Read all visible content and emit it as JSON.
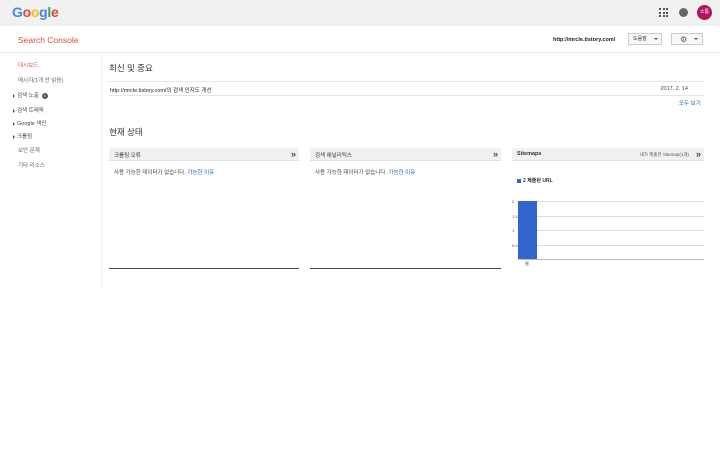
{
  "header": {
    "logo_text": "Google",
    "logo_colors": [
      "#4285f4",
      "#ea4335",
      "#fbbc05",
      "#4285f4",
      "#34a853",
      "#ea4335"
    ],
    "apps_icon": "apps-grid-icon",
    "notifications_icon": "bell-icon",
    "avatar_initials": "소통",
    "avatar_color": "#b0155d"
  },
  "subheader": {
    "product_title": "Search Console",
    "site_url": "http://mrcle.tistory.com/",
    "help_label": "도움말",
    "settings_icon": "gear-icon"
  },
  "sidebar": {
    "items": [
      {
        "label": "대시보드"
      },
      {
        "label": "메시지(1개 안 읽음)"
      },
      {
        "label": "검색 노출"
      },
      {
        "label": "검색 트래픽"
      },
      {
        "label": "Google 색인"
      },
      {
        "label": "크롤링"
      },
      {
        "label": "보안 문제"
      },
      {
        "label": "기타 리소스"
      }
    ],
    "active_color": "#dd4b39"
  },
  "main": {
    "news_heading": "최신 및 중요",
    "news_item": {
      "message": "http://mrcle.tistory.com/의 검색 인지도 개선",
      "date": "2017. 2. 14"
    },
    "see_all": "모두 보기",
    "status_heading": "현재 상태",
    "cards": [
      {
        "title": "크롤링 오류",
        "body": "사용 가능한 데이터가 없습니다.",
        "link": "가능한 이유",
        "arrow": "»"
      },
      {
        "title": "검색 애널리틱스",
        "body": "사용 가능한 데이터가 없습니다.",
        "link": "가능한 이유",
        "arrow": "»"
      },
      {
        "title": "Sitemaps",
        "note": "내가 제출한 Sitemap(1개)",
        "legend": "2 제출된 URL",
        "arrow": "»"
      }
    ]
  },
  "chart_data": {
    "type": "bar",
    "categories": [
      "웹"
    ],
    "series": [
      {
        "name": "2 제출된 URL",
        "values": [
          2
        ]
      }
    ],
    "yticks": [
      "2",
      "1.5",
      "1",
      "0.5"
    ],
    "ylim": [
      0,
      2
    ],
    "bar_color": "#3366cc"
  }
}
